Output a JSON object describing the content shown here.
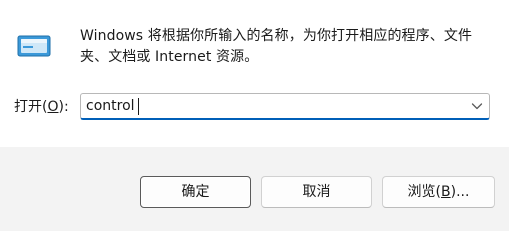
{
  "dialog": {
    "description": "Windows 将根据你所输入的名称，为你打开相应的程序、文件夹、文档或 Internet 资源。",
    "app_icon": "run-dialog-icon"
  },
  "open_field": {
    "label_prefix": "打开(",
    "label_accel": "O",
    "label_suffix": "):",
    "value": "control",
    "dropdown_icon": "chevron-down-icon"
  },
  "buttons": {
    "ok_label": "确定",
    "cancel_label": "取消",
    "browse_prefix": "浏览(",
    "browse_accel": "B",
    "browse_suffix": ")..."
  },
  "colors": {
    "accent": "#005fb8",
    "footer_bg": "#f3f3f3"
  }
}
